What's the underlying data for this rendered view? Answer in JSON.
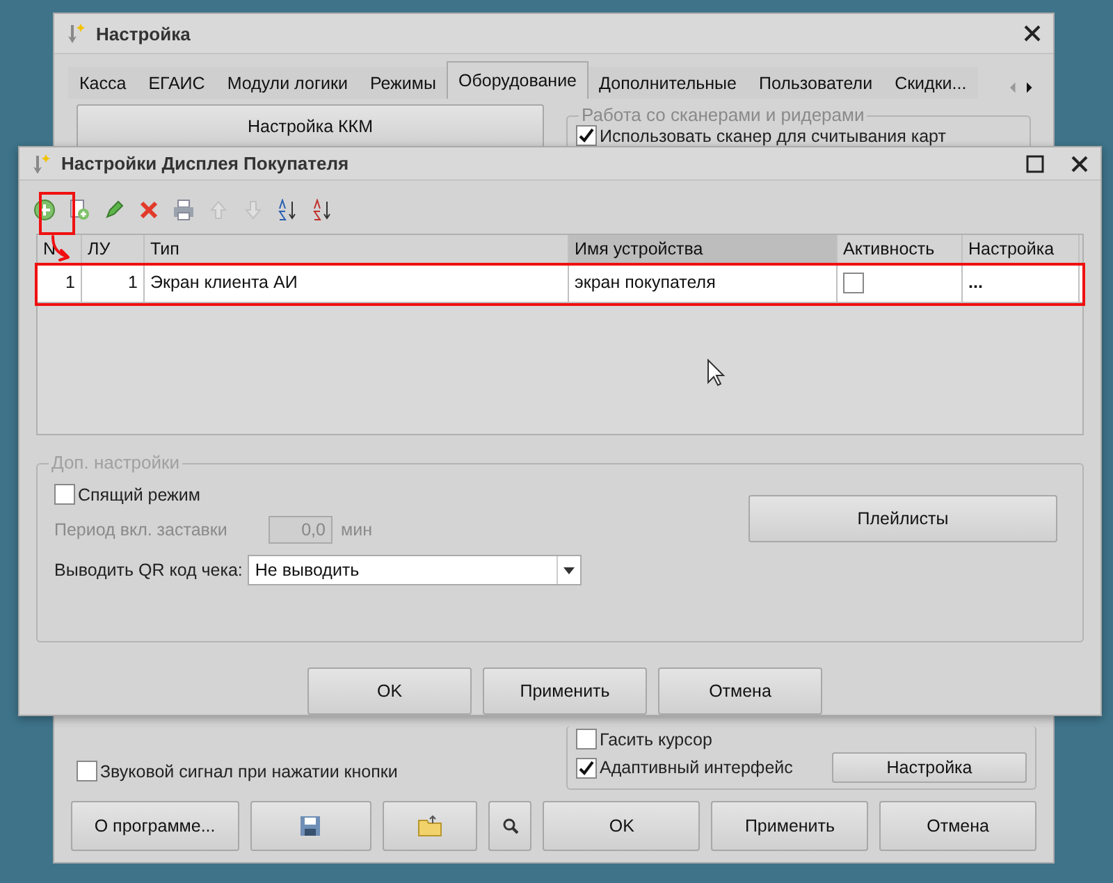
{
  "main_window": {
    "title": "Настройка",
    "tabs": [
      {
        "label": "Касса",
        "selected": false
      },
      {
        "label": "ЕГАИС",
        "selected": false
      },
      {
        "label": "Модули логики",
        "selected": false
      },
      {
        "label": "Режимы",
        "selected": false
      },
      {
        "label": "Оборудование",
        "selected": true
      },
      {
        "label": "Дополнительные",
        "selected": false
      },
      {
        "label": "Пользователи",
        "selected": false
      },
      {
        "label": "Скидки...",
        "selected": false
      }
    ],
    "kkm_button": "Настройка ККМ",
    "scanner_group": {
      "title": "Работа со сканерами и ридерами",
      "checkbox": {
        "label": "Использовать сканер для считывания карт",
        "checked": true
      }
    },
    "sound_checkbox": {
      "label": "Звуковой сигнал при нажатии кнопки",
      "checked": false
    },
    "cursor_checkbox": {
      "label": "Гасить курсор",
      "checked": false
    },
    "adaptive_checkbox": {
      "label": "Адаптивный интерфейс",
      "checked": true
    },
    "adaptive_button": "Настройка",
    "about_button": "О программе...",
    "ok_button": "OK",
    "apply_button": "Применить",
    "cancel_button": "Отмена"
  },
  "dialog": {
    "title": "Настройки Дисплея Покупателя",
    "columns": [
      {
        "label": "N",
        "selected": false
      },
      {
        "label": "ЛУ",
        "selected": false
      },
      {
        "label": "Тип",
        "selected": false
      },
      {
        "label": "Имя устройства",
        "selected": true
      },
      {
        "label": "Активность",
        "selected": false
      },
      {
        "label": "Настройка",
        "selected": false
      }
    ],
    "rows": [
      {
        "n": "1",
        "lu": "1",
        "type": "Экран клиента АИ",
        "device": "экран покупателя",
        "active": false,
        "settings": "..."
      }
    ],
    "extra": {
      "title": "Доп. настройки",
      "sleep": {
        "label": "Спящий режим",
        "checked": false
      },
      "period": {
        "label": "Период вкл. заставки",
        "value": "0,0",
        "unit": "мин",
        "disabled": true
      },
      "qr": {
        "label": "Выводить QR код чека:",
        "value": "Не выводить"
      },
      "playlists_button": "Плейлисты"
    },
    "buttons": [
      "OK",
      "Применить",
      "Отмена"
    ]
  }
}
